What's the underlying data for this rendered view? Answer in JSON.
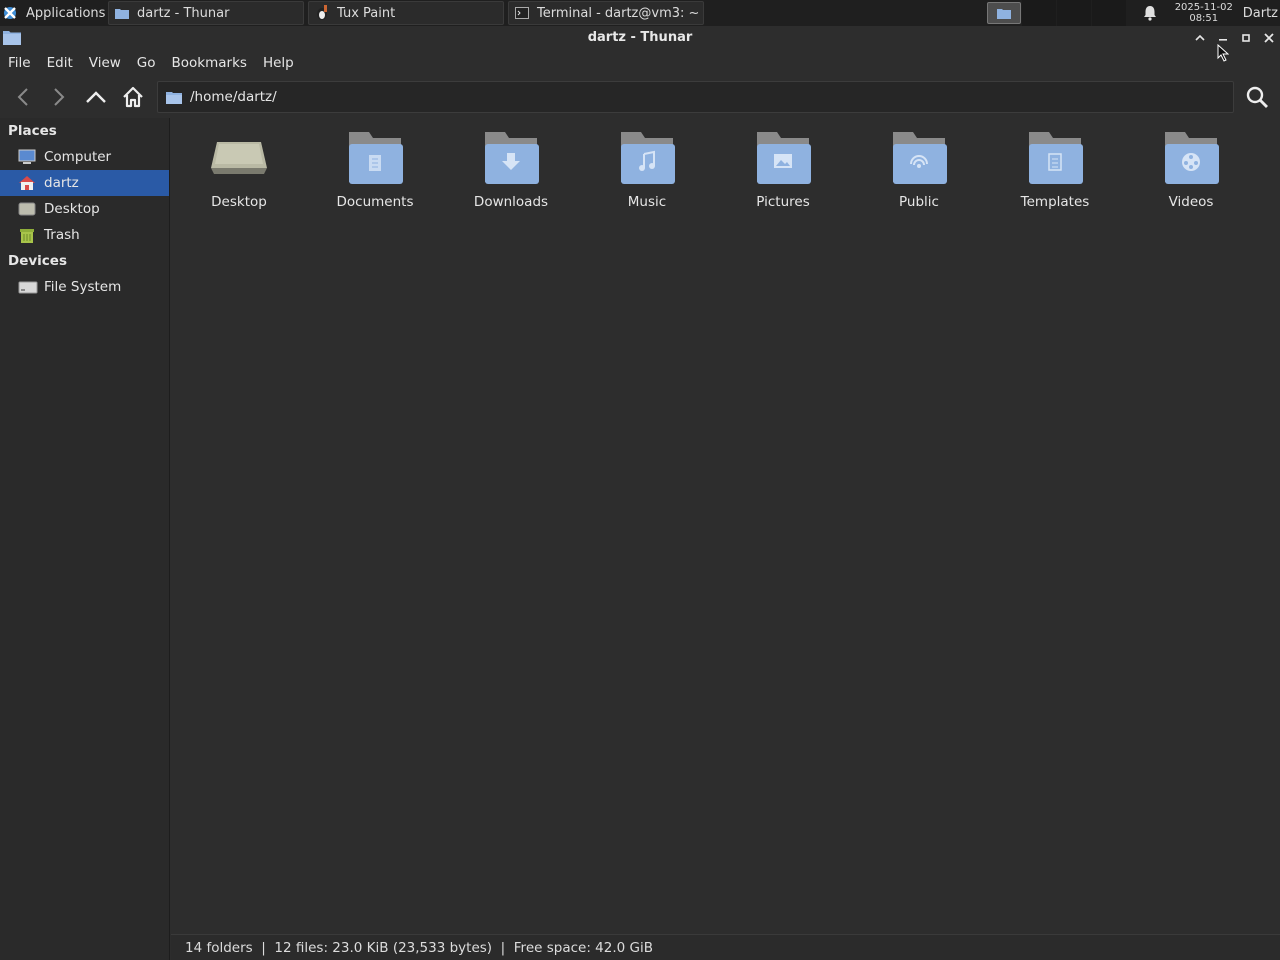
{
  "taskbar": {
    "applications_label": "Applications",
    "windows": [
      {
        "label": "dartz - Thunar",
        "icon": "folder-icon"
      },
      {
        "label": "Tux Paint",
        "icon": "tux-paint-icon"
      },
      {
        "label": "Terminal - dartz@vm3: ~",
        "icon": "terminal-icon"
      }
    ],
    "clock_date": "2025-11-02",
    "clock_time": "08:51",
    "user": "Dartz"
  },
  "window": {
    "title": "dartz - Thunar"
  },
  "menubar": {
    "items": [
      "File",
      "Edit",
      "View",
      "Go",
      "Bookmarks",
      "Help"
    ]
  },
  "toolbar": {
    "location_path": "/home/dartz/"
  },
  "sidebar": {
    "places_title": "Places",
    "places": [
      {
        "label": "Computer",
        "icon": "computer-icon"
      },
      {
        "label": "dartz",
        "icon": "home-icon",
        "selected": true
      },
      {
        "label": "Desktop",
        "icon": "desktop-icon"
      },
      {
        "label": "Trash",
        "icon": "trash-icon"
      }
    ],
    "devices_title": "Devices",
    "devices": [
      {
        "label": "File System",
        "icon": "drive-icon"
      }
    ]
  },
  "files": [
    {
      "label": "Desktop",
      "icon": "desktop-folder-icon"
    },
    {
      "label": "Documents",
      "icon": "documents-folder-icon"
    },
    {
      "label": "Downloads",
      "icon": "downloads-folder-icon"
    },
    {
      "label": "Music",
      "icon": "music-folder-icon"
    },
    {
      "label": "Pictures",
      "icon": "pictures-folder-icon"
    },
    {
      "label": "Public",
      "icon": "public-folder-icon"
    },
    {
      "label": "Templates",
      "icon": "templates-folder-icon"
    },
    {
      "label": "Videos",
      "icon": "videos-folder-icon"
    }
  ],
  "statusbar": {
    "text": "14 folders  |  12 files: 23.0 KiB (23,533 bytes)  |  Free space: 42.0 GiB"
  },
  "colors": {
    "selection": "#2a5aa6",
    "background": "#2d2d2d",
    "folder": "#8fb2e0"
  }
}
